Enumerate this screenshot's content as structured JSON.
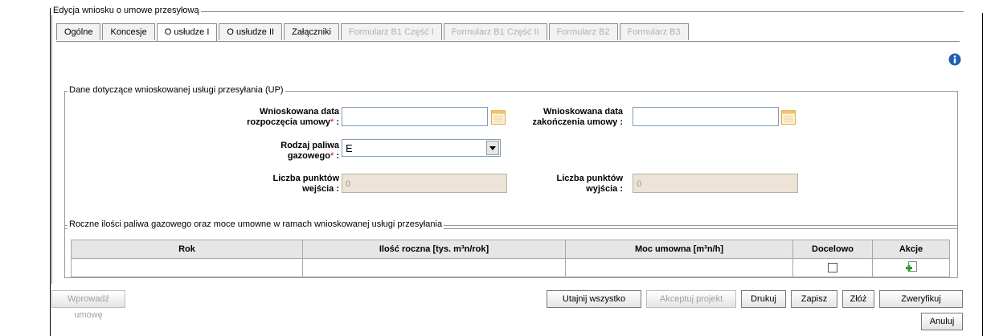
{
  "form_title": "Edycja wniosku o umowe przesyłową",
  "tabs": [
    {
      "label": "Ogólne",
      "state": "normal"
    },
    {
      "label": "Koncesje",
      "state": "normal"
    },
    {
      "label": "O usłudze I",
      "state": "active"
    },
    {
      "label": "O usłudze II",
      "state": "normal"
    },
    {
      "label": "Załączniki",
      "state": "normal"
    },
    {
      "label": "Formularz B1 Część I",
      "state": "disabled"
    },
    {
      "label": "Formularz B1 Część II",
      "state": "disabled"
    },
    {
      "label": "Formularz B2",
      "state": "disabled"
    },
    {
      "label": "Formularz B3",
      "state": "disabled"
    }
  ],
  "section1": {
    "legend": "Dane dotyczące wnioskowanej usługi przesyłania (UP)",
    "start_date": {
      "label_line1": "Wnioskowana data",
      "label_line2": "rozpoczęcia umowy",
      "required_mark": "*",
      "colon": ":",
      "value": ""
    },
    "end_date": {
      "label_line1": "Wnioskowana data",
      "label_line2": "zakończenia umowy :",
      "value": ""
    },
    "fuel_type": {
      "label_line1": "Rodzaj paliwa",
      "label_line2": "gazowego",
      "required_mark": "*",
      "colon": ":",
      "value": "E"
    },
    "entry_points": {
      "label_line1": "Liczba punktów",
      "label_line2": "wejścia :",
      "value": "0"
    },
    "exit_points": {
      "label_line1": "Liczba punktów",
      "label_line2": "wyjścia :",
      "value": "0"
    }
  },
  "section2": {
    "legend": "Roczne ilości paliwa gazowego oraz moce umowne w ramach wnioskowanej usługi przesyłania",
    "columns": [
      "Rok",
      "Ilość roczna [tys. m³n/rok]",
      "Moc umowna [m³n/h]",
      "Docelowo",
      "Akcje"
    ]
  },
  "buttons": {
    "enter_contract": "Wprowadź umowę",
    "hide_all": "Utajnij wszystko",
    "accept_project": "Akceptuj projekt",
    "print": "Drukuj",
    "save": "Zapisz",
    "submit": "Złóż",
    "verify": "Zweryfikuj",
    "cancel": "Anuluj"
  },
  "colors": {
    "tab_border": "#8c8c8c",
    "required": "#cc0000",
    "disabled_input": "#ede4d7",
    "info_icon": "#1e5fb4"
  }
}
